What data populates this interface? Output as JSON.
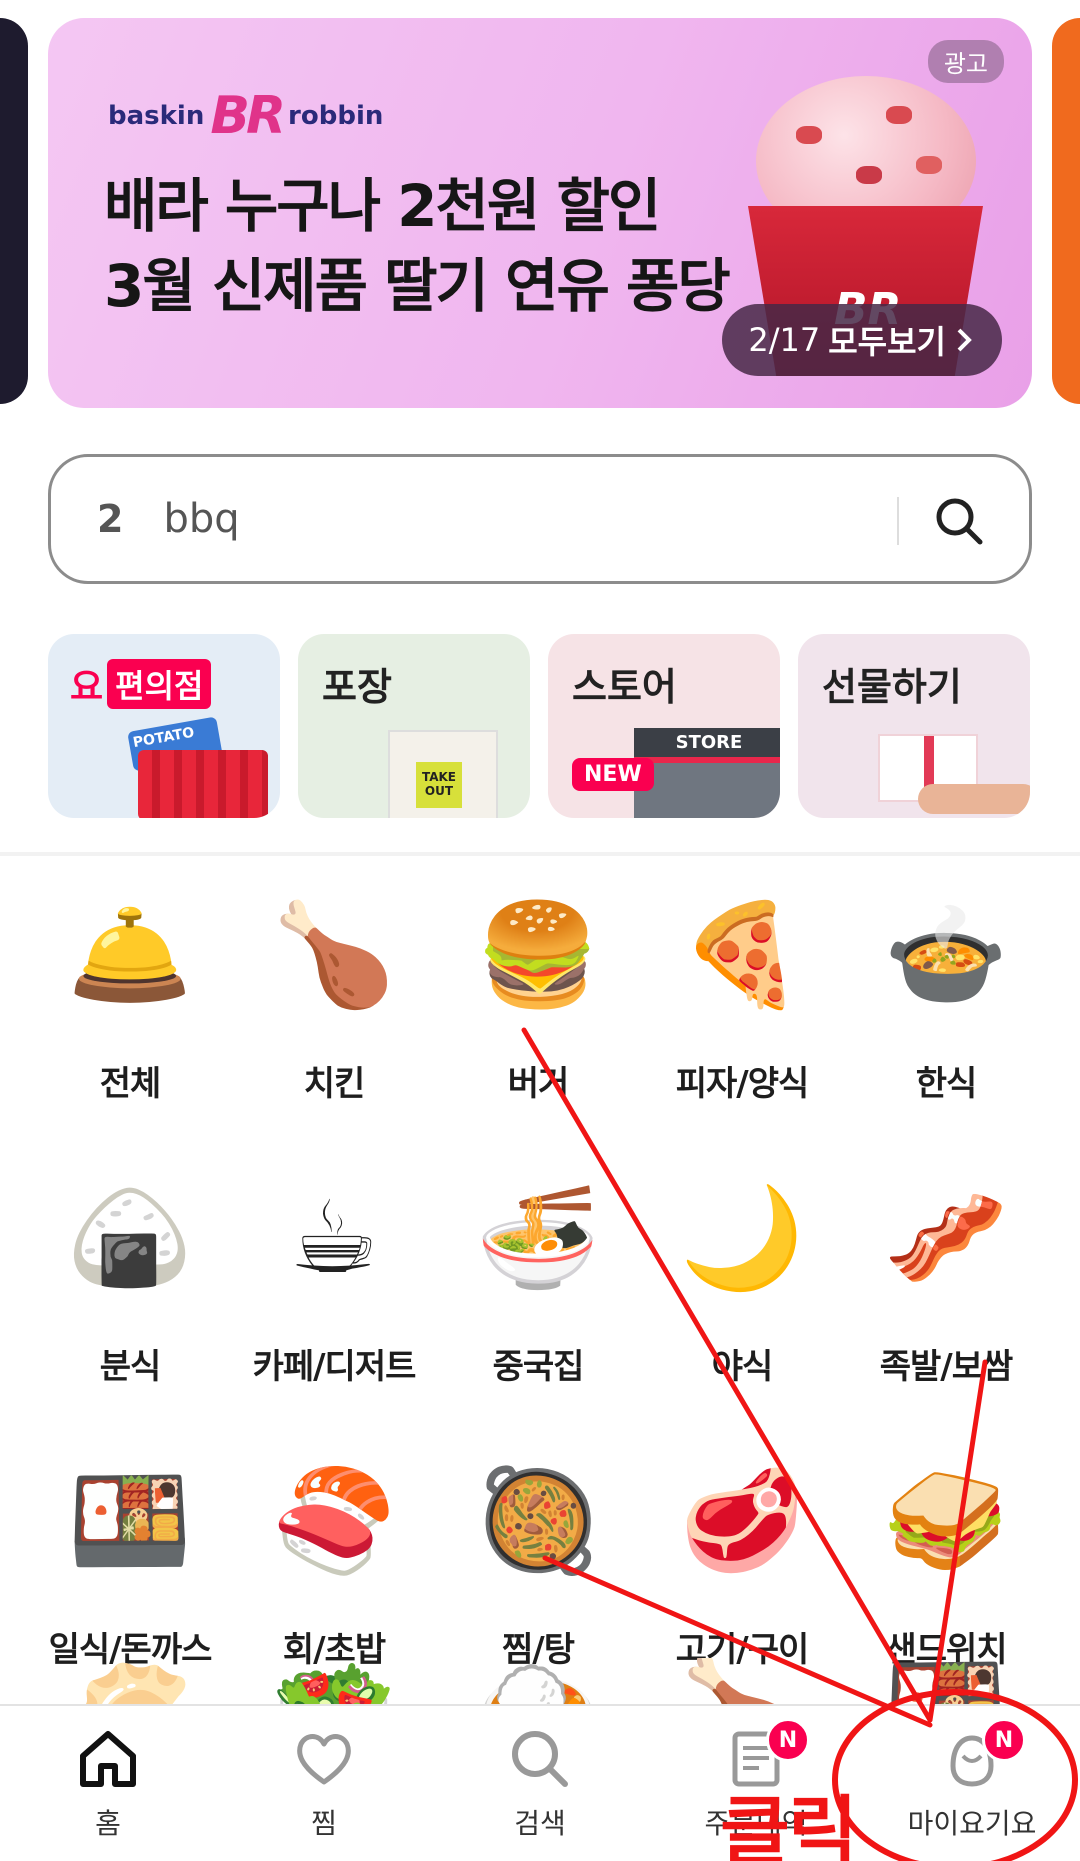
{
  "banner": {
    "ad_badge": "광고",
    "brand_left": "baskin",
    "brand_mark": "BR",
    "brand_right": "robbin",
    "headline_line1": "배라 누구나 2천원 할인",
    "headline_line2": "3월 신제품 딸기 연유 퐁당",
    "counter": "2/17",
    "view_all": "모두보기",
    "cup_logo": "BR"
  },
  "search": {
    "rank": "2",
    "keyword": "bbq"
  },
  "quick_cards": [
    {
      "logo": "요",
      "label": "편의점",
      "chips_text": "POTATO"
    },
    {
      "label": "포장",
      "tag_text": "TAKE OUT"
    },
    {
      "label": "스토어",
      "new_badge": "NEW",
      "store_sign": "STORE"
    },
    {
      "label": "선물하기"
    }
  ],
  "categories": [
    {
      "label": "전체",
      "icon": "🛎️"
    },
    {
      "label": "치킨",
      "icon": "🍗"
    },
    {
      "label": "버거",
      "icon": "🍔"
    },
    {
      "label": "피자/양식",
      "icon": "🍕"
    },
    {
      "label": "한식",
      "icon": "🍲"
    },
    {
      "label": "분식",
      "icon": "🍙"
    },
    {
      "label": "카페/디저트",
      "icon": "☕"
    },
    {
      "label": "중국집",
      "icon": "🍜"
    },
    {
      "label": "야식",
      "icon": "🌙"
    },
    {
      "label": "족발/보쌈",
      "icon": "🥓"
    },
    {
      "label": "일식/돈까스",
      "icon": "🍱"
    },
    {
      "label": "회/초밥",
      "icon": "🍣"
    },
    {
      "label": "찜/탕",
      "icon": "🥘"
    },
    {
      "label": "고기/구이",
      "icon": "🥩"
    },
    {
      "label": "샌드위치",
      "icon": "🥪"
    }
  ],
  "nav": {
    "home": "홈",
    "favorites": "찜",
    "search": "검색",
    "orders": "주문내역",
    "orders_badge": "N",
    "my": "마이요기요",
    "my_badge": "N"
  },
  "annotation": {
    "click_label": "클릭",
    "color": "#f01515"
  }
}
